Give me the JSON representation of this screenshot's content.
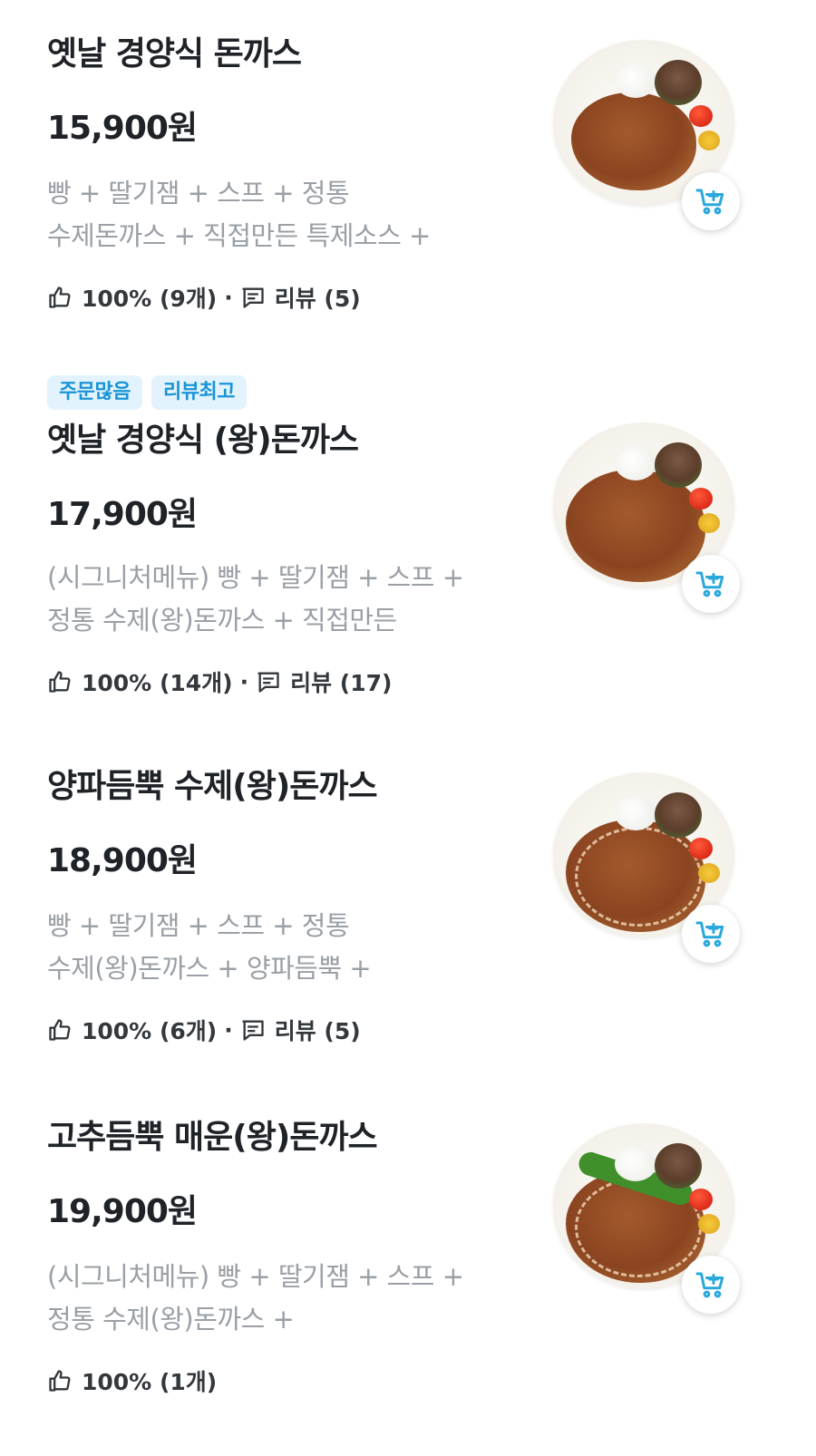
{
  "menu_items": [
    {
      "badges": [],
      "name": "옛날 경양식 돈까스",
      "price": "15,900원",
      "desc_line1": "빵 + 딸기잼 + 스프 + 정통",
      "desc_line2": "수제돈까스 + 직접만든 특제소스 +",
      "like_text": "100% (9개)",
      "review_text": "리뷰 (5)"
    },
    {
      "badges": [
        "주문많음",
        "리뷰최고"
      ],
      "name": "옛날 경양식 (왕)돈까스",
      "price": "17,900원",
      "desc_line1": "(시그니처메뉴) 빵 + 딸기잼 + 스프 +",
      "desc_line2": "정통 수제(왕)돈까스 + 직접만든",
      "like_text": "100% (14개)",
      "review_text": "리뷰 (17)"
    },
    {
      "badges": [],
      "name": "양파듬뿍 수제(왕)돈까스",
      "price": "18,900원",
      "desc_line1": "빵 + 딸기잼 + 스프 + 정통",
      "desc_line2": "수제(왕)돈까스 + 양파듬뿍 +",
      "like_text": "100% (6개)",
      "review_text": "리뷰 (5)"
    },
    {
      "badges": [],
      "name": "고추듬뿍 매운(왕)돈까스",
      "price": "19,900원",
      "desc_line1": "(시그니처메뉴) 빵 + 딸기잼 + 스프 +",
      "desc_line2": "정통 수제(왕)돈까스 +",
      "like_text": "100% (1개)",
      "review_text": ""
    }
  ],
  "icons": {
    "like": "thumbs-up-icon",
    "review": "comment-icon",
    "cart": "cart-plus-icon"
  },
  "colors": {
    "badge_bg": "#e3f3fd",
    "badge_text": "#1a94d6",
    "cart_icon": "#2aa8dc",
    "desc_text": "#9aa0a6"
  }
}
